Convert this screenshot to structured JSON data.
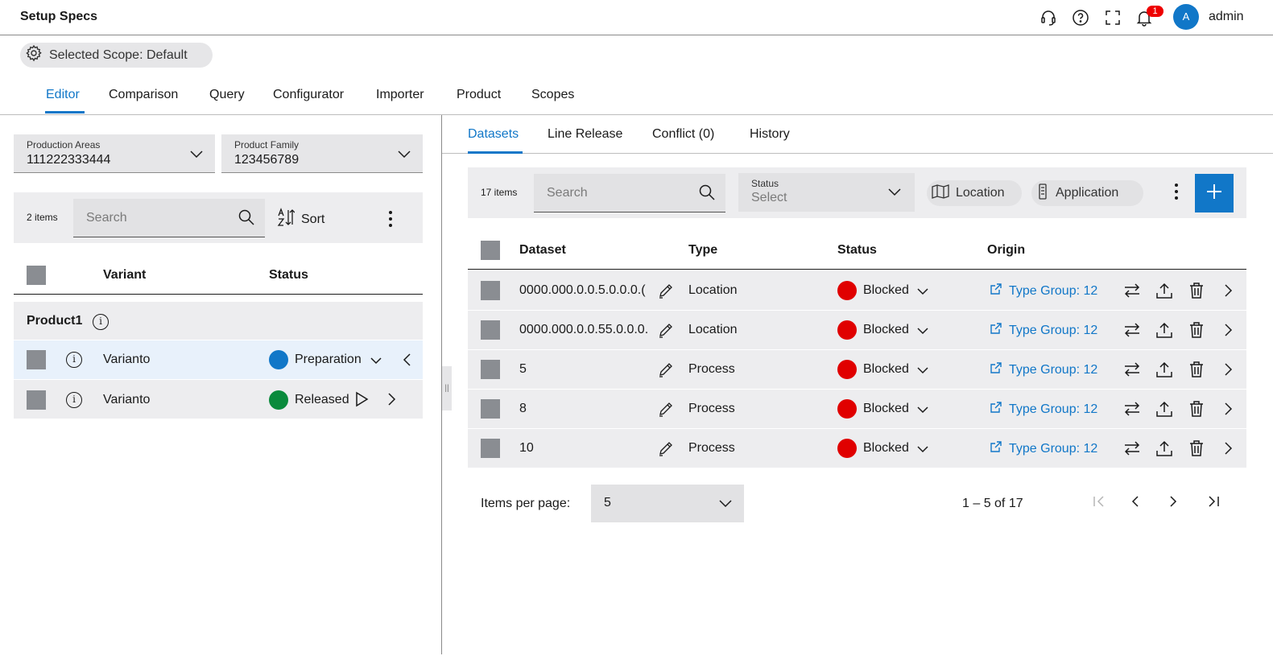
{
  "header": {
    "title": "Setup Specs",
    "notification_count": "1",
    "avatar_initial": "A",
    "user_name": "admin"
  },
  "scope": {
    "label": "Selected Scope: Default"
  },
  "main_tabs": [
    "Editor",
    "Comparison",
    "Query",
    "Configurator",
    "Importer",
    "Product",
    "Scopes"
  ],
  "left_panel": {
    "production_areas": {
      "label": "Production Areas",
      "value": "111222333444"
    },
    "product_family": {
      "label": "Product Family",
      "value": "123456789"
    },
    "items_count": "2 items",
    "search_placeholder": "Search",
    "sort_label": "Sort",
    "columns": {
      "variant": "Variant",
      "status": "Status"
    },
    "group": "Product1",
    "rows": [
      {
        "name": "Varianto",
        "status": "Preparation",
        "status_color": "#1177c8"
      },
      {
        "name": "Varianto",
        "status": "Released",
        "status_color": "#0a8a3c"
      }
    ]
  },
  "right_panel": {
    "tabs": [
      "Datasets",
      "Line Release",
      "Conflict (0)",
      "History"
    ],
    "items_count": "17 items",
    "search_placeholder": "Search",
    "status_filter": {
      "label": "Status",
      "value": "Select"
    },
    "chips": {
      "location": "Location",
      "application": "Application"
    },
    "columns": {
      "dataset": "Dataset",
      "type": "Type",
      "status": "Status",
      "origin": "Origin"
    },
    "rows": [
      {
        "dataset": "0000.000.0.0.5.0.0.0.(",
        "type": "Location",
        "status": "Blocked",
        "origin": "Type Group: 12"
      },
      {
        "dataset": "0000.000.0.0.55.0.0.0.",
        "type": "Location",
        "status": "Blocked",
        "origin": "Type Group: 12"
      },
      {
        "dataset": "5",
        "type": "Process",
        "status": "Blocked",
        "origin": "Type Group: 12"
      },
      {
        "dataset": "8",
        "type": "Process",
        "status": "Blocked",
        "origin": "Type Group: 12"
      },
      {
        "dataset": "10",
        "type": "Process",
        "status": "Blocked",
        "origin": "Type Group: 12"
      }
    ],
    "status_color": "#e00000",
    "pagination": {
      "label": "Items per page:",
      "per_page": "5",
      "range": "1 – 5 of 17"
    }
  },
  "colors": {
    "accent": "#1177c8",
    "blocked": "#e00000",
    "released": "#0a8a3c"
  }
}
